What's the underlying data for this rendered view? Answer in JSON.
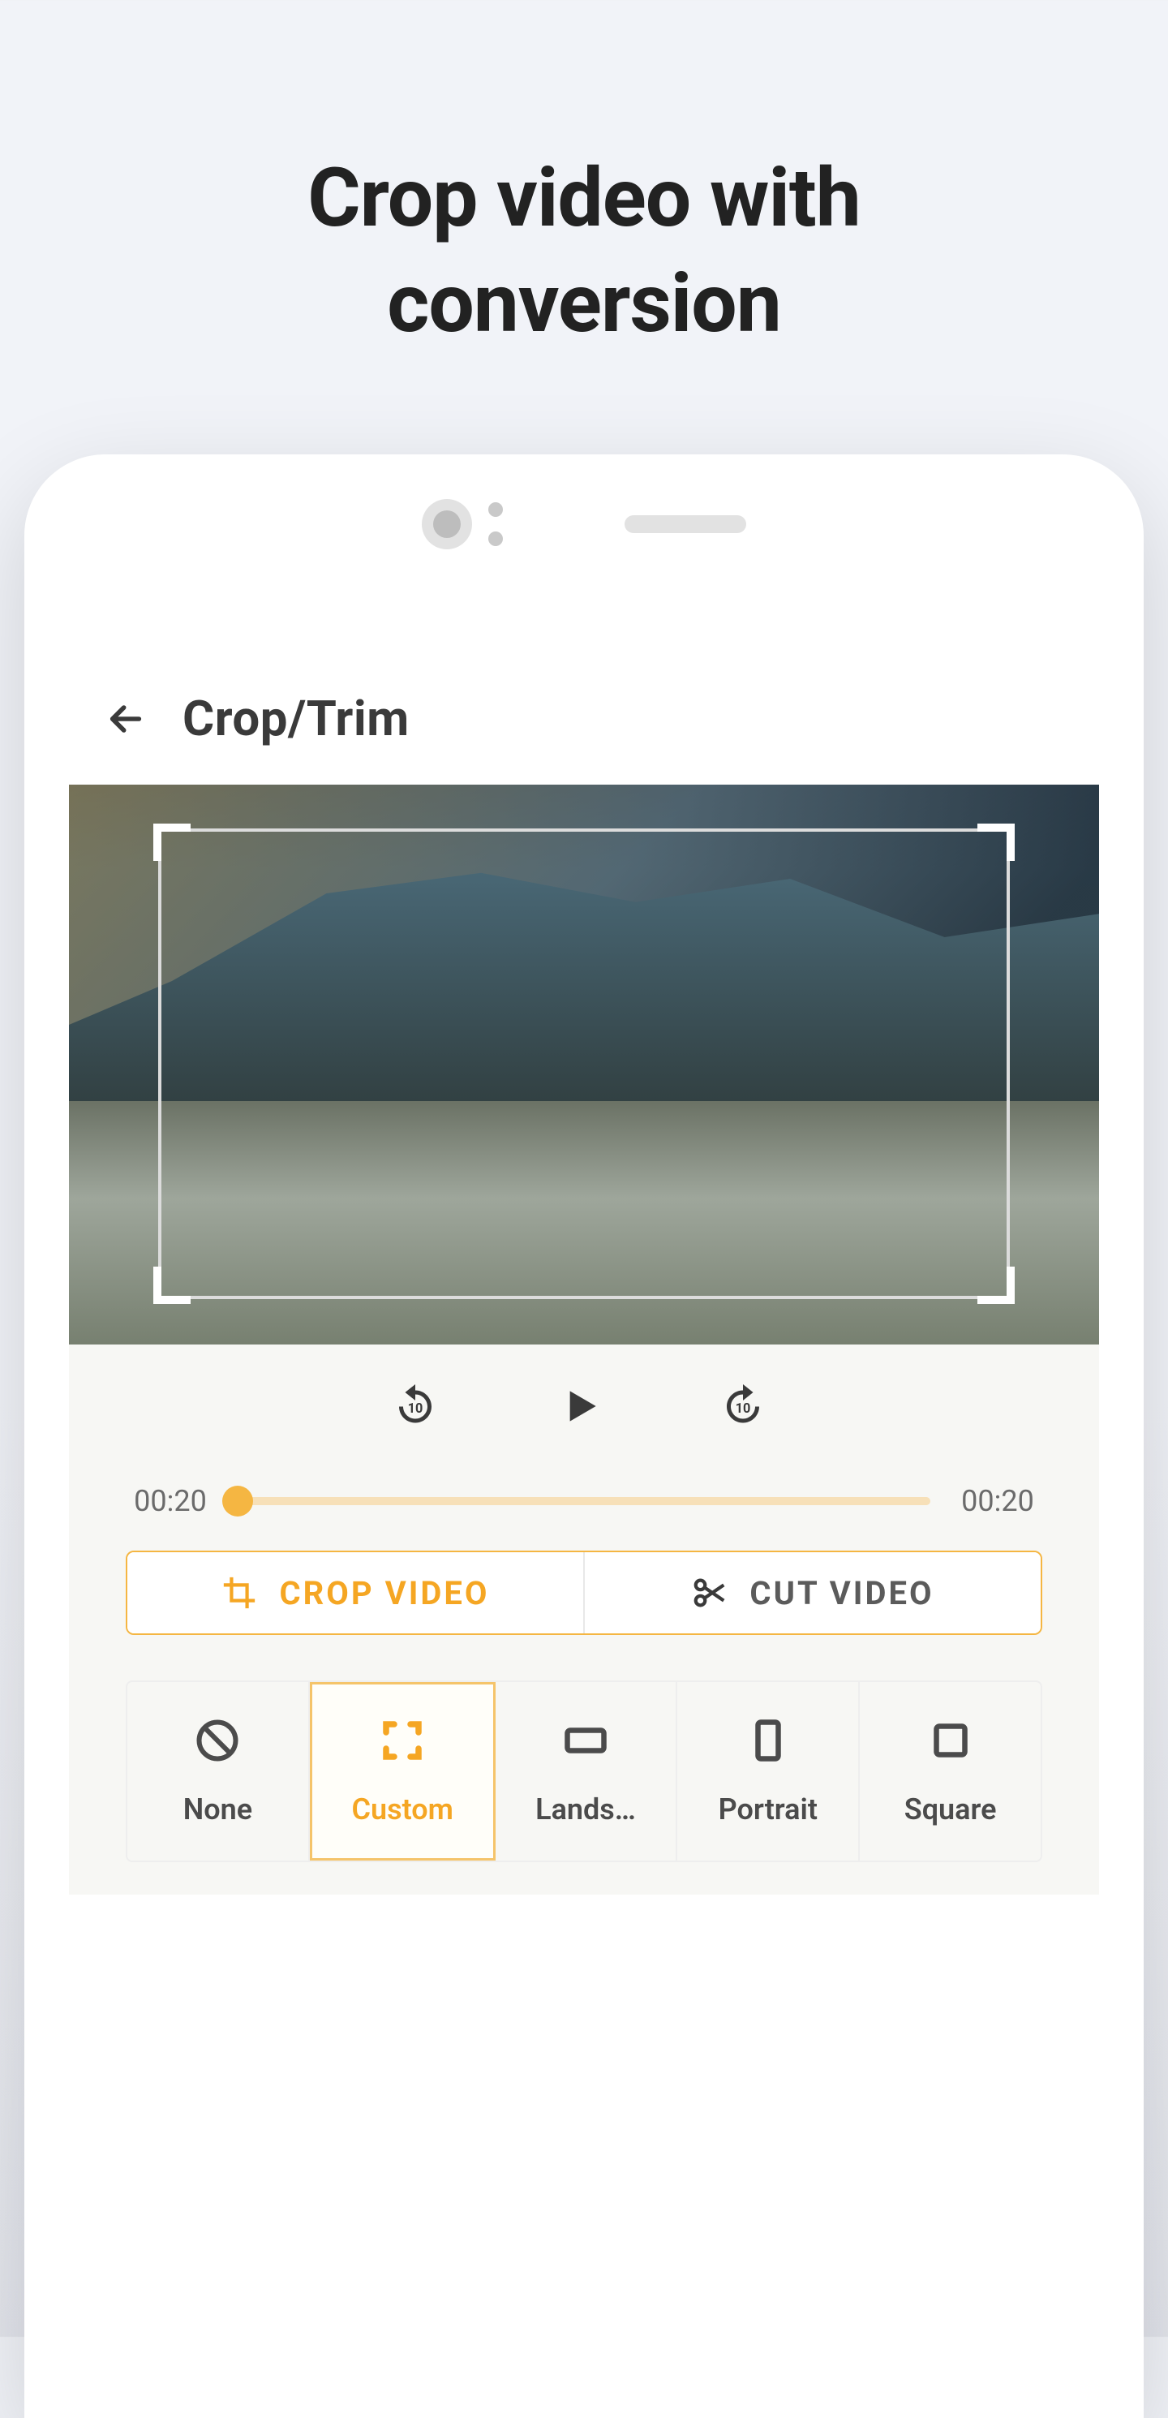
{
  "marketing": {
    "headline_line1": "Crop video with",
    "headline_line2": "conversion"
  },
  "header": {
    "title": "Crop/Trim"
  },
  "playback": {
    "current_time": "00:20",
    "total_time": "00:20",
    "rewind_seconds": "10",
    "forward_seconds": "10"
  },
  "tabs": {
    "crop_label": "CROP VIDEO",
    "cut_label": "CUT VIDEO",
    "active": "crop"
  },
  "aspect_options": [
    {
      "id": "none",
      "label": "None",
      "icon": "ban-icon",
      "selected": false
    },
    {
      "id": "custom",
      "label": "Custom",
      "icon": "crop-free-icon",
      "selected": true
    },
    {
      "id": "landscape",
      "label": "Lands…",
      "icon": "landscape-rect-icon",
      "selected": false
    },
    {
      "id": "portrait",
      "label": "Portrait",
      "icon": "portrait-rect-icon",
      "selected": false
    },
    {
      "id": "square",
      "label": "Square",
      "icon": "square-icon",
      "selected": false
    }
  ],
  "colors": {
    "accent": "#f5a623"
  }
}
